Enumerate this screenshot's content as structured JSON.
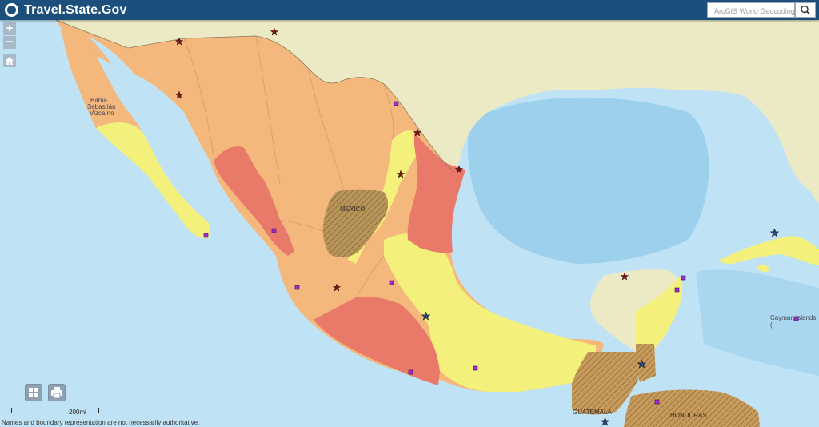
{
  "header": {
    "brand": "Travel.State.Gov",
    "search_placeholder": "ArcGIS World Geocoding S"
  },
  "controls": {
    "zoom_in": "+",
    "zoom_out": "−"
  },
  "labels": {
    "bahia": "Bahía",
    "sebastian": "Sebastián",
    "vizcaino": "Vizcaíno",
    "mexico": "MEXICO",
    "cayman": "Cayman Islands (",
    "guatemala": "GUATEMALA",
    "honduras": "HONDURAS"
  },
  "scale": {
    "label": "200mi"
  },
  "footer": {
    "disclaimer": "Names and boundary representation are not necessarily authoritative."
  },
  "colors": {
    "header": "#1d4f7c",
    "water": "#bfe3f4",
    "land": "#eceac5",
    "level_1": "#f4f07c",
    "level_2": "#f4b77c",
    "level_3": "#e97a6a",
    "us_embassy_star": "#7a1616",
    "consulate_star": "#1f4e8a",
    "agency_square": "#a12fd0"
  }
}
